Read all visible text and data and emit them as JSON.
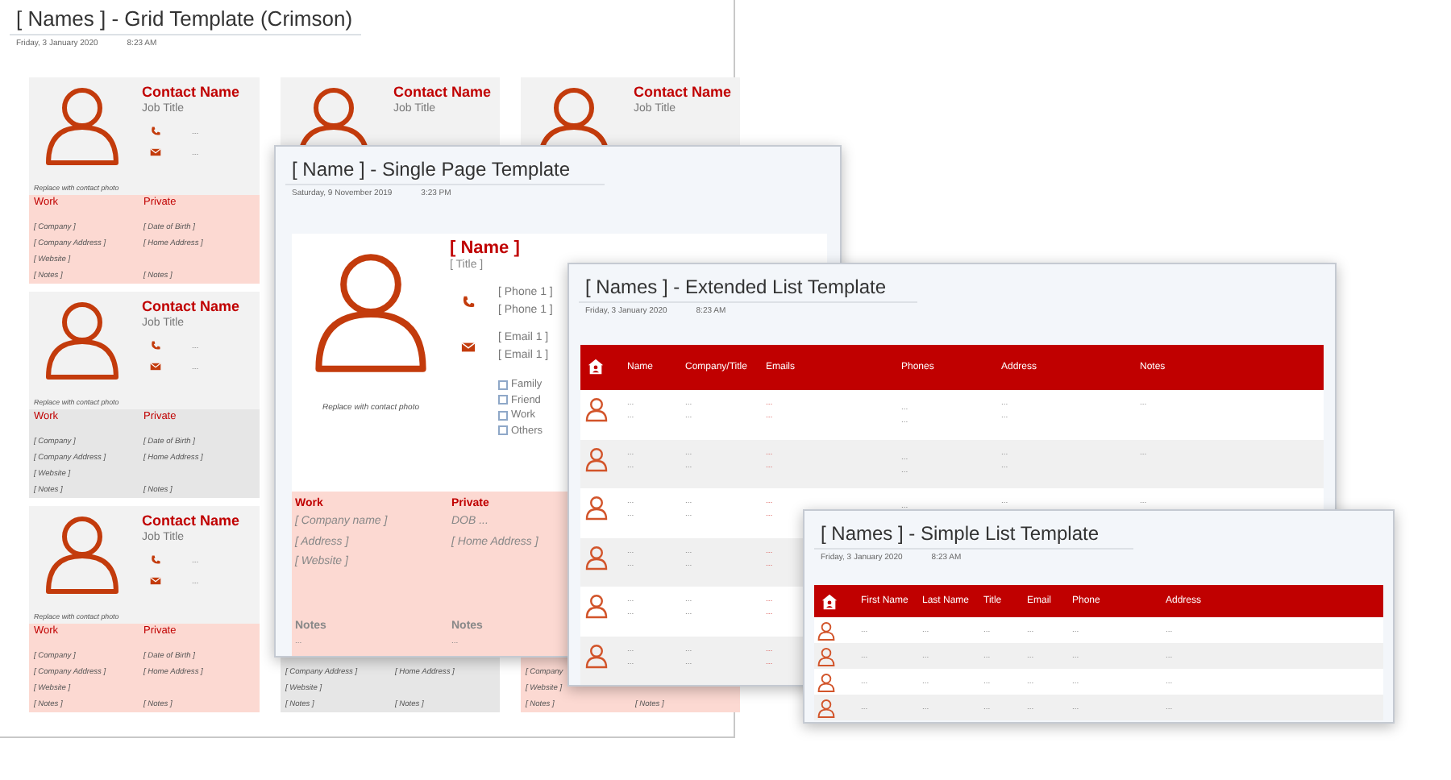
{
  "grid_window": {
    "title": "[ Names ] - Grid Template (Crimson)",
    "date": "Friday, 3 January 2020",
    "time": "8:23 AM",
    "rows": [
      [
        {
          "name": "Contact Name",
          "title": "Job Title",
          "phone": "...",
          "email": "...",
          "caption": "Replace with contact photo",
          "work_heading": "Work",
          "private_heading": "Private",
          "color": "#fcd9d2",
          "rows": [
            [
              "[ Company ]",
              "[ Date of Birth ]"
            ],
            [
              "[ Company  Address ]",
              "[ Home Address ]"
            ],
            [
              "[ Website ]"
            ],
            [
              "[ Notes ]",
              "[ Notes ]"
            ]
          ]
        },
        {
          "name": "Contact Name",
          "title": "Job Title"
        },
        {
          "name": "Contact Name",
          "title": "Job Title"
        }
      ],
      [
        {
          "name": "Contact Name",
          "title": "Job Title",
          "phone": "...",
          "email": "...",
          "caption": "Replace with contact photo",
          "work_heading": "Work",
          "private_heading": "Private",
          "color": "#e6e6e6",
          "rows": [
            [
              "[ Company ]",
              "[ Date of Birth ]"
            ],
            [
              "[ Company  Address ]",
              "[ Home Address ]"
            ],
            [
              "[ Website ]"
            ],
            [
              "[ Notes ]",
              "[ Notes ]"
            ]
          ]
        }
      ],
      [
        {
          "name": "Contact Name",
          "title": "Job Title",
          "phone": "...",
          "email": "...",
          "caption": "Replace with contact photo",
          "work_heading": "Work",
          "private_heading": "Private",
          "color": "#fcd9d2",
          "rows": [
            [
              "[ Company ]",
              "[ Date of Birth ]"
            ],
            [
              "[ Company  Address ]",
              "[ Home Address ]"
            ],
            [
              "[ Website ]"
            ],
            [
              "[ Notes ]",
              "[ Notes ]"
            ]
          ]
        },
        {
          "color": "#e6e6e6",
          "rows": [
            [
              "[ Company  Address ]",
              "[ Home Address ]"
            ],
            [
              "[ Website ]"
            ],
            [
              "[ Notes ]",
              "[ Notes ]"
            ]
          ]
        },
        {
          "color": "#fcd9d2",
          "rows": [
            [
              "[ Company"
            ],
            [
              "[ Website ]"
            ],
            [
              "[ Notes ]",
              "[ Notes ]"
            ]
          ]
        }
      ]
    ]
  },
  "single_window": {
    "title": "[ Name ] - Single Page Template",
    "date": "Saturday, 9 November 2019",
    "time": "3:23 PM",
    "name": "[ Name ]",
    "job_title": "[ Title ]",
    "phones": [
      "[ Phone 1 ]",
      "[ Phone 1 ]"
    ],
    "emails": [
      "[ Email 1 ]",
      "[ Email 1 ]"
    ],
    "caption": "Replace with contact photo",
    "categories": [
      {
        "label": "Family",
        "checked": false
      },
      {
        "label": "Friend",
        "checked": false
      },
      {
        "label": "Work",
        "checked": false
      },
      {
        "label": "Others",
        "checked": false
      }
    ],
    "work": {
      "heading": "Work",
      "lines": [
        "[ Company name ]",
        "[ Address ]",
        "[ Website ]"
      ],
      "notes_heading": "Notes",
      "notes": "..."
    },
    "private": {
      "heading": "Private",
      "lines": [
        "DOB ...",
        "[ Home Address ]"
      ],
      "notes_heading": "Notes",
      "notes": "..."
    }
  },
  "extended_window": {
    "title": "[ Names ] - Extended List Template",
    "date": "Friday, 3 January 2020",
    "time": "8:23 AM",
    "columns": [
      "Name",
      "Company/Title",
      "Emails",
      "Phones",
      "Address",
      "Notes"
    ],
    "rows": [
      {
        "cells": [
          [
            "...",
            "..."
          ],
          [
            "...",
            "..."
          ],
          [
            "...",
            "..."
          ],
          [
            "...",
            "..."
          ],
          [
            "...",
            "..."
          ],
          [
            "..."
          ]
        ]
      },
      {
        "cells": [
          [
            "...",
            "..."
          ],
          [
            "...",
            "..."
          ],
          [
            "...",
            "..."
          ],
          [
            "...",
            "..."
          ],
          [
            "...",
            "..."
          ],
          [
            "..."
          ]
        ]
      },
      {
        "cells": [
          [
            "...",
            "..."
          ],
          [
            "...",
            "..."
          ],
          [
            "...",
            "..."
          ],
          [
            "..."
          ],
          [
            "..."
          ],
          [
            "..."
          ]
        ]
      },
      {
        "cells": [
          [
            "...",
            "..."
          ],
          [
            "...",
            "..."
          ],
          [
            "...",
            "..."
          ]
        ]
      },
      {
        "cells": [
          [
            "...",
            "..."
          ],
          [
            "...",
            "..."
          ],
          [
            "...",
            "..."
          ]
        ]
      },
      {
        "cells": [
          [
            "...",
            "..."
          ],
          [
            "...",
            "..."
          ],
          [
            "...",
            "..."
          ]
        ]
      }
    ]
  },
  "simple_window": {
    "title": "[ Names ] - Simple List Template",
    "date": "Friday, 3 January 2020",
    "time": "8:23 AM",
    "columns": [
      "First Name",
      "Last Name",
      "Title",
      "Email",
      "Phone",
      "Address"
    ],
    "rows": [
      [
        "...",
        "...",
        "...",
        "...",
        "...",
        "..."
      ],
      [
        "...",
        "...",
        "...",
        "...",
        "...",
        "..."
      ],
      [
        "...",
        "...",
        "...",
        "...",
        "...",
        "..."
      ],
      [
        "...",
        "...",
        "...",
        "...",
        "...",
        "..."
      ]
    ]
  }
}
